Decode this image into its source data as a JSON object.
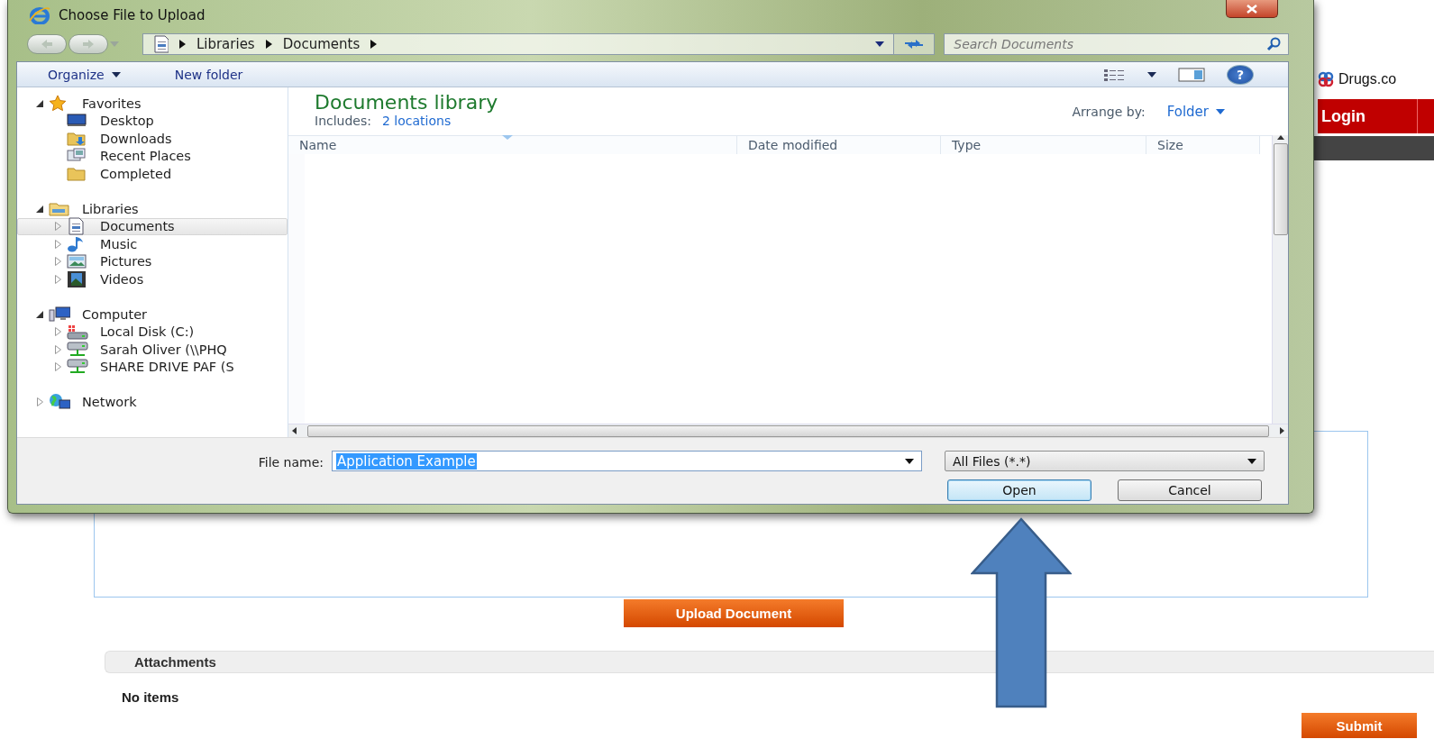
{
  "page": {
    "brand": "Drugs.co",
    "login": "Login",
    "upload_button": "Upload Document",
    "attachments": {
      "title": "Attachments",
      "empty": "No items"
    },
    "submit": "Submit"
  },
  "dialog": {
    "title": "Choose File to Upload",
    "breadcrumb": [
      "Libraries",
      "Documents"
    ],
    "search": {
      "placeholder": "Search Documents"
    },
    "toolbar": [
      "Organize",
      "New folder"
    ],
    "help_button": "?",
    "navigation": [
      {
        "label": "Favorites",
        "expanded": true,
        "selected": false,
        "children": [
          {
            "label": "Desktop",
            "selected": false
          },
          {
            "label": "Downloads",
            "selected": false
          },
          {
            "label": "Recent Places",
            "selected": false
          },
          {
            "label": "Completed",
            "selected": false
          }
        ]
      },
      {
        "label": "Libraries",
        "expanded": true,
        "selected": false,
        "children": [
          {
            "label": "Documents",
            "expanded": false,
            "selected": true
          },
          {
            "label": "Music",
            "expanded": false,
            "selected": false
          },
          {
            "label": "Pictures",
            "expanded": false,
            "selected": false
          },
          {
            "label": "Videos",
            "expanded": false,
            "selected": false
          }
        ]
      },
      {
        "label": "Computer",
        "expanded": true,
        "selected": false,
        "children": [
          {
            "label": "Local Disk (C:)",
            "expanded": false,
            "selected": false
          },
          {
            "label": "Sarah Oliver (\\\\PHQ",
            "expanded": false,
            "selected": false
          },
          {
            "label": "SHARE DRIVE PAF (S",
            "expanded": false,
            "selected": false
          }
        ]
      },
      {
        "label": "Network",
        "expanded": false,
        "selected": false
      }
    ],
    "library": {
      "title": "Documents library",
      "includes_label": "Includes:",
      "includes_link": "2 locations",
      "arrange_label": "Arrange by:",
      "arrange_value": "Folder"
    },
    "columns": [
      "Name",
      "Date modified",
      "Type",
      "Size"
    ],
    "file_name": {
      "label": "File name:",
      "value": "Application Example",
      "text_selected": true
    },
    "file_type": "All Files (*.*)",
    "buttons": [
      {
        "label": "Open",
        "default": true
      },
      {
        "label": "Cancel",
        "default": false
      }
    ]
  }
}
